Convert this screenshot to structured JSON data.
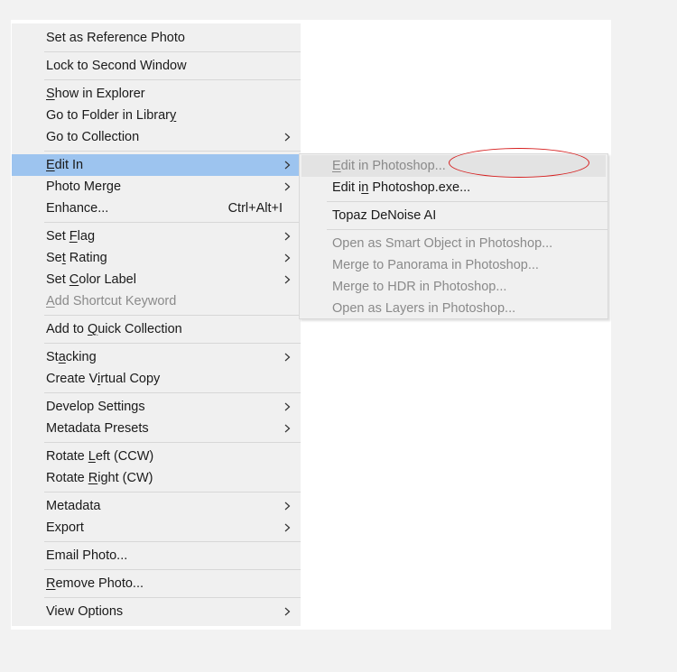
{
  "main_menu": {
    "set_reference_photo": "Set as Reference Photo",
    "lock_second_window": "Lock to Second Window",
    "show_in_explorer": {
      "pre": "",
      "key": "S",
      "post": "how in Explorer"
    },
    "go_to_folder": {
      "pre": "Go to Folder in Librar",
      "key": "y",
      "post": ""
    },
    "go_to_collection": "Go to Collection",
    "edit_in": {
      "pre": "",
      "key": "E",
      "post": "dit In"
    },
    "photo_merge": "Photo Merge",
    "enhance": "Enhance...",
    "enhance_shortcut": "Ctrl+Alt+I",
    "set_flag": {
      "pre": "Set ",
      "key": "F",
      "post": "lag"
    },
    "set_rating": {
      "pre": "Se",
      "key": "t",
      "post": " Rating"
    },
    "set_color_label": {
      "pre": "Set ",
      "key": "C",
      "post": "olor Label"
    },
    "add_shortcut_keyword": {
      "pre": "",
      "key": "A",
      "post": "dd Shortcut Keyword"
    },
    "add_quick_collection": {
      "pre": "Add to ",
      "key": "Q",
      "post": "uick Collection"
    },
    "stacking": {
      "pre": "St",
      "key": "a",
      "post": "cking"
    },
    "create_virtual_copy": {
      "pre": "Create V",
      "key": "i",
      "post": "rtual Copy"
    },
    "develop_settings": "Develop Settings",
    "metadata_presets": "Metadata Presets",
    "rotate_left": {
      "pre": "Rotate ",
      "key": "L",
      "post": "eft (CCW)"
    },
    "rotate_right": {
      "pre": "Rotate ",
      "key": "R",
      "post": "ight (CW)"
    },
    "metadata": "Metadata",
    "export": "Export",
    "email_photo": "Email Photo...",
    "remove_photo": {
      "pre": "",
      "key": "R",
      "post": "emove Photo..."
    },
    "view_options": "View Options"
  },
  "sub_menu": {
    "edit_in_photoshop": {
      "pre": "",
      "key": "E",
      "post": "dit in Photoshop..."
    },
    "edit_in_photoshop_exe": {
      "pre": "Edit i",
      "key": "n",
      "post": " Photoshop.exe..."
    },
    "topaz_denoise": "Topaz DeNoise AI",
    "open_smart_object": "Open as Smart Object in Photoshop...",
    "merge_panorama": "Merge to Panorama in Photoshop...",
    "merge_hdr": "Merge to HDR in Photoshop...",
    "open_as_layers": "Open as Layers in Photoshop..."
  },
  "colors": {
    "highlight": "#9dc4ef",
    "annotation": "#d61f1f",
    "disabled_text": "#8a8a8a"
  }
}
